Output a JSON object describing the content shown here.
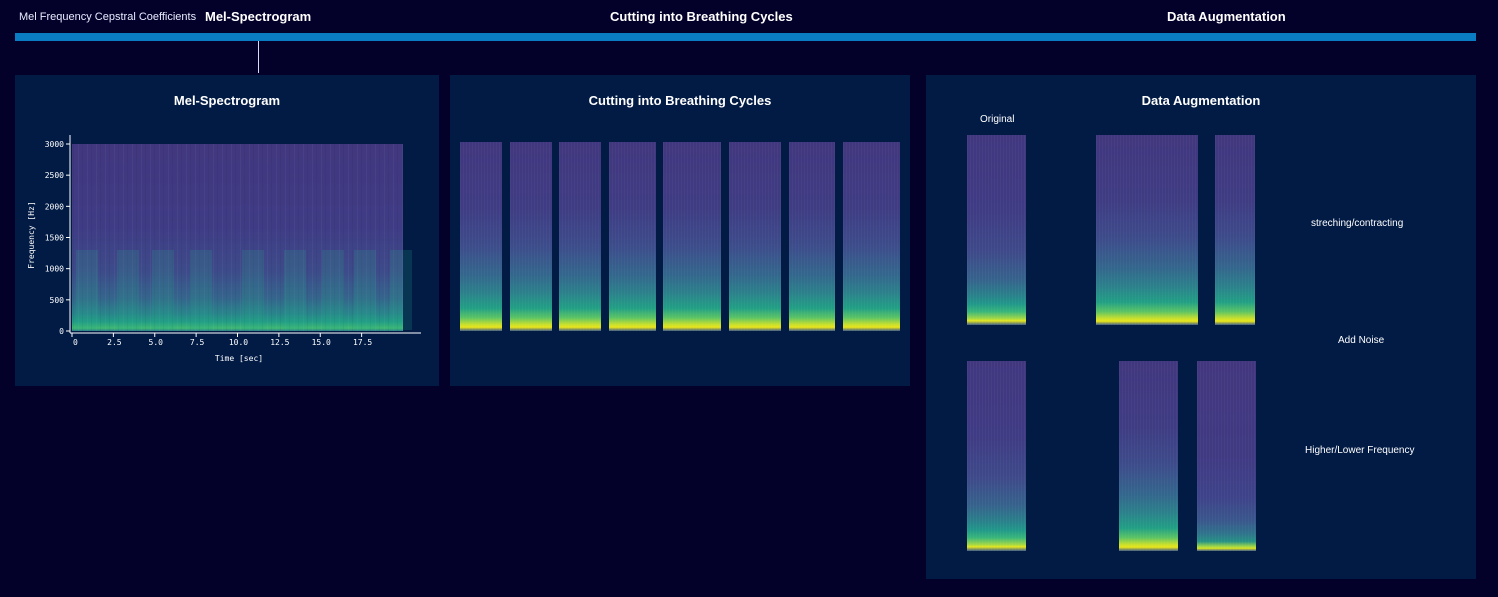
{
  "nav": {
    "current_label": "Mel Frequency Cepstral Coefficients",
    "tabs": [
      {
        "label": "Mel-Spectrogram"
      },
      {
        "label": "Cutting into Breathing Cycles"
      },
      {
        "label": "Data Augmentation"
      }
    ]
  },
  "panels": {
    "mel": {
      "title": "Mel-Spectrogram"
    },
    "cycles": {
      "title": "Cutting into Breathing Cycles",
      "cycle_count": 8
    },
    "augmentation": {
      "title": "Data Augmentation",
      "original_label": "Original",
      "stretch_label": "streching/contracting",
      "noise_label": "Add Noise",
      "frequency_label": "Higher/Lower Frequency"
    }
  },
  "colors": {
    "background": "#03002a",
    "panel": "#021b45",
    "accent": "#0a7cc4"
  },
  "chart_data": {
    "type": "heatmap",
    "title": "",
    "xlabel": "Time [sec]",
    "ylabel": "Frequency [Hz]",
    "x_ticks": [
      0,
      2.5,
      5.0,
      7.5,
      10.0,
      12.5,
      15.0,
      17.5
    ],
    "x_tick_labels": [
      "0",
      "2.5",
      "5.0",
      "7.5",
      "10.0",
      "12.5",
      "15.0",
      "17.5"
    ],
    "y_ticks": [
      0,
      500,
      1000,
      1500,
      2000,
      2500,
      3000
    ],
    "y_tick_labels": [
      "0",
      "500",
      "1000",
      "1500",
      "2000",
      "2500",
      "3000"
    ],
    "xlim": [
      0,
      20
    ],
    "ylim": [
      0,
      3000
    ],
    "colormap": "viridis"
  }
}
